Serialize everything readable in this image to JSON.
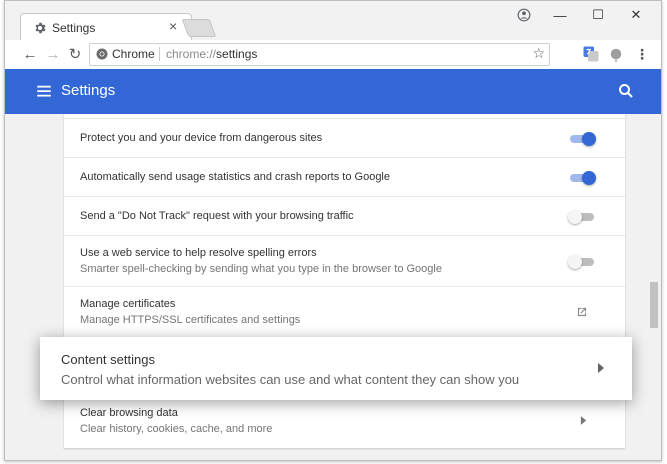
{
  "browser": {
    "tab": {
      "title": "Settings",
      "close": "×"
    },
    "window_controls": {
      "minimize": "—",
      "maximize": "☐",
      "close": "✕"
    },
    "nav": {
      "back": "←",
      "forward": "→",
      "reload": "↻"
    },
    "omnibox": {
      "chip_label": "Chrome",
      "url_scheme": "chrome://",
      "url_path": "settings",
      "star": "☆"
    }
  },
  "appbar": {
    "title": "Settings",
    "accent": "#3367d6"
  },
  "settings_rows": [
    {
      "label": "Protect you and your device from dangerous sites",
      "toggle": true
    },
    {
      "label": "Automatically send usage statistics and crash reports to Google",
      "toggle": true
    },
    {
      "label": "Send a \"Do Not Track\" request with your browsing traffic",
      "toggle": false
    },
    {
      "label": "Use a web service to help resolve spelling errors",
      "sublabel": "Smarter spell-checking by sending what you type in the browser to Google",
      "toggle": false
    },
    {
      "label": "Manage certificates",
      "sublabel": "Manage HTTPS/SSL certificates and settings",
      "icon": "open-in-new-icon"
    },
    {
      "label": "Clear browsing data",
      "sublabel": "Clear history, cookies, cache, and more",
      "icon": "chevron-right-icon"
    }
  ],
  "content_settings": {
    "label": "Content settings",
    "sublabel": "Control what information websites can use and what content they can show you",
    "icon": "chevron-right-icon"
  }
}
